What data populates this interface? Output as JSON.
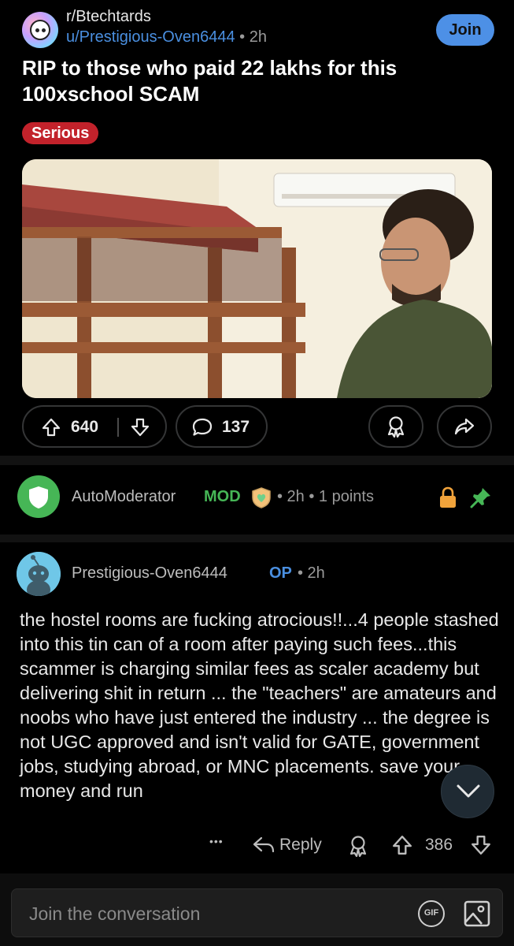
{
  "post": {
    "subreddit": "r/Btechtards",
    "author": "u/Prestigious-Oven6444",
    "separator": "•",
    "time": "2h",
    "join_label": "Join",
    "title": "RIP to those who paid 22 lakhs for this 100xschool SCAM",
    "flair": "Serious",
    "flair_color": "#c2222b",
    "upvotes": "640",
    "comments": "137"
  },
  "mod_comment": {
    "author": "AutoModerator",
    "tag": "MOD",
    "meta": "• 2h • 1 points",
    "tag_color": "#46b656"
  },
  "op_comment": {
    "author": "Prestigious-Oven6444",
    "tag": "OP",
    "meta": "• 2h",
    "body": "the hostel rooms are fucking atrocious!!...4 people stashed into this tin can of a room after paying such fees...this scammer is charging similar fees as scaler academy but delivering shit in return ... the \"teachers\" are amateurs and noobs who have just entered the industry ... the degree is not UGC approved and isn't valid for GATE, government jobs, studying abroad, or MNC placements. save your money and run",
    "more_label": "•••",
    "reply_label": "Reply",
    "upvotes": "386"
  },
  "composer": {
    "placeholder": "Join the conversation",
    "gif_label": "GIF"
  },
  "colors": {
    "background": "#000000",
    "link_blue": "#4a8fe0",
    "join_button": "#4d90e6",
    "mod_green": "#46b656"
  }
}
